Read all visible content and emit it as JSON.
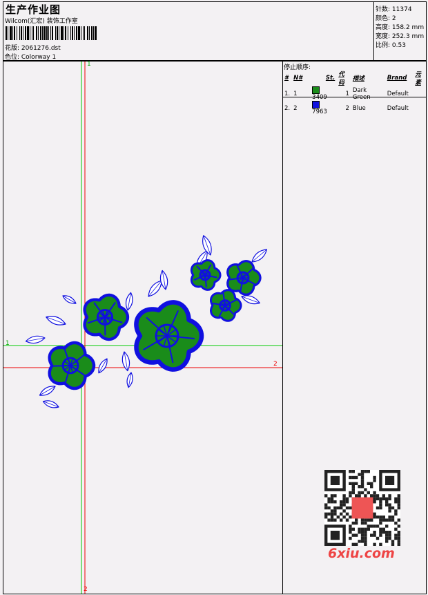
{
  "header": {
    "title": "生产作业图",
    "company": "Wilcom(汇宏) 装饰工作室",
    "design_label": "花版: 2061276.dst",
    "colorway_label": "色位: Colorway 1"
  },
  "stats": [
    {
      "label": "针数",
      "value": "11374"
    },
    {
      "label": "颜色",
      "value": "2"
    },
    {
      "label": "高度",
      "value": "158.2 mm"
    },
    {
      "label": "宽度",
      "value": "252.3 mm"
    },
    {
      "label": "比例",
      "value": "0.53"
    }
  ],
  "stop_sequence": {
    "heading": "停止顺序:",
    "columns": [
      "#",
      "N#",
      "St.",
      "代码",
      "描述",
      "Brand",
      "元素"
    ],
    "rows": [
      {
        "num": "1.",
        "n": "1",
        "stitches": "3409",
        "code": "1",
        "description": "Dark Green",
        "brand": "Default",
        "color": "#1a8c1a"
      },
      {
        "num": "2.",
        "n": "2",
        "stitches": "7963",
        "code": "2",
        "description": "Blue",
        "brand": "Default",
        "color": "#1010e0"
      }
    ]
  },
  "axis_labels": {
    "green_top": "1",
    "green_right": "1",
    "red_right": "2",
    "red_bottom": "2"
  },
  "watermark": {
    "text": "6xiu.com"
  },
  "colors": {
    "thread_green": "#1a8c1a",
    "thread_blue": "#1010e0",
    "guide_green": "#00cc00",
    "guide_red": "#ee0000"
  }
}
